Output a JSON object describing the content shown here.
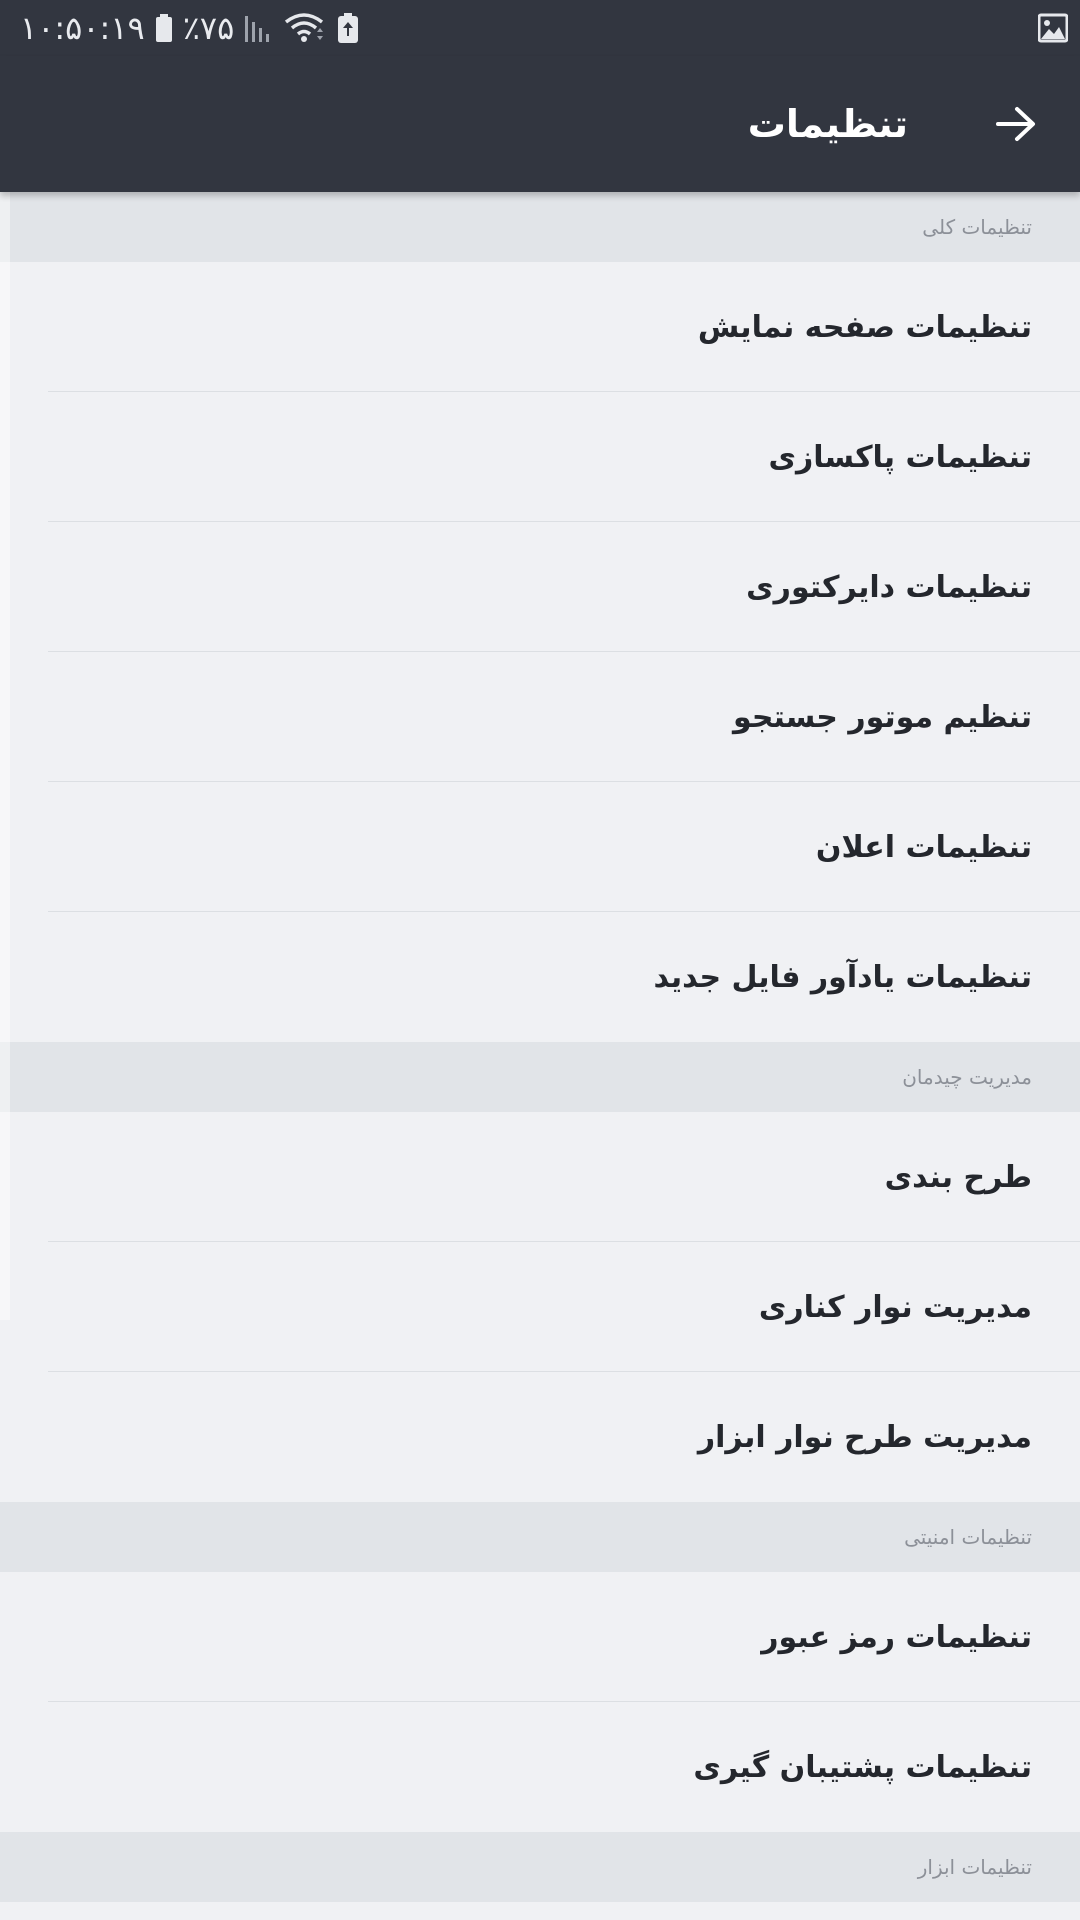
{
  "status_bar": {
    "time": "۱۰:۵۰:۱۹",
    "battery_percent": "٪۷۵",
    "icons": [
      "battery-icon",
      "signal-icon",
      "wifi-icon",
      "battery-saver-icon",
      "image-notification-icon"
    ]
  },
  "app_bar": {
    "title": "تنظیمات",
    "back_icon": "arrow-right-icon"
  },
  "sections": [
    {
      "header": "تنظیمات کلی",
      "items": [
        "تنظیمات صفحه نمایش",
        "تنظیمات پاکسازی",
        "تنظیمات دایرکتوری",
        "تنظیم موتور جستجو",
        "تنظیمات اعلان",
        "تنظیمات یادآور فایل جدید"
      ]
    },
    {
      "header": "مدیریت چیدمان",
      "items": [
        "طرح بندی",
        "مدیریت نوار کناری",
        "مدیریت طرح نوار ابزار"
      ]
    },
    {
      "header": "تنظیمات امنیتی",
      "items": [
        "تنظیمات رمز عبور",
        "تنظیمات پشتیبان گیری"
      ]
    },
    {
      "header": "تنظیمات ابزار",
      "items": []
    }
  ],
  "colors": {
    "toolbar": "#323640",
    "background": "#f0f1f4",
    "section_header_bg": "#e1e4e8",
    "section_header_text": "#8c9098",
    "item_text": "#24272d"
  }
}
